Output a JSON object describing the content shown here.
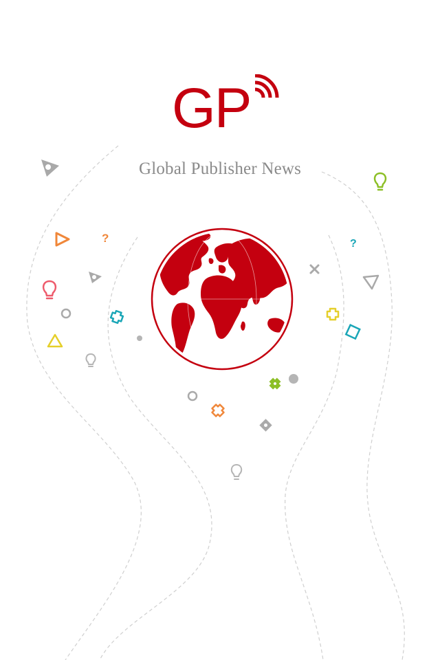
{
  "splash": {
    "logo": {
      "letters": "GP",
      "color": "#c4000f",
      "signal_icon": "broadcast-signal-icon"
    },
    "app_title": "Global Publisher News",
    "globe_icon": "globe-icon",
    "accent_colors": {
      "red": "#c4000f",
      "orange": "#f0873a",
      "teal": "#1aa6b7",
      "lime": "#8cbf26",
      "yellow": "#e5cf2a",
      "pink": "#ee5a6b",
      "gray": "#aaaaaa"
    }
  }
}
